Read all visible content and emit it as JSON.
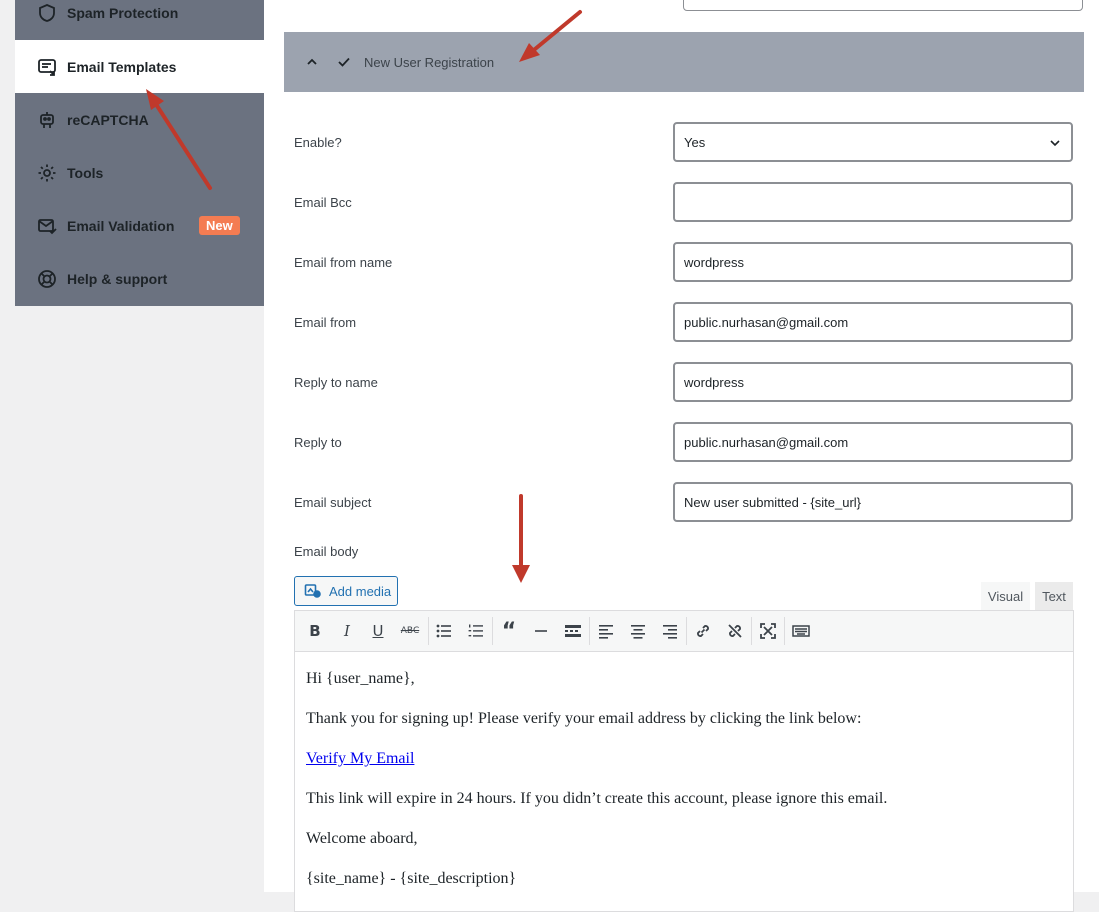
{
  "sidebar": {
    "items": [
      {
        "label": "Spam Protection",
        "icon": "shield-icon"
      },
      {
        "label": "Email Templates",
        "icon": "email-template-icon",
        "active": true
      },
      {
        "label": "reCAPTCHA",
        "icon": "robot-icon"
      },
      {
        "label": "Tools",
        "icon": "gear-icon"
      },
      {
        "label": "Email Validation",
        "icon": "envelope-check-icon",
        "badge": "New"
      },
      {
        "label": "Help & support",
        "icon": "lifebuoy-icon"
      }
    ],
    "active_bg": "#ffffff",
    "bg": "#6b7280",
    "badge_color": "#f47c52"
  },
  "accordion": {
    "title": "New User Registration",
    "bg": "#9ca3af"
  },
  "form": {
    "enable": {
      "label": "Enable?",
      "value": "Yes"
    },
    "bcc": {
      "label": "Email Bcc",
      "value": ""
    },
    "from_name": {
      "label": "Email from name",
      "value": "wordpress"
    },
    "from": {
      "label": "Email from",
      "value": "public.nurhasan@gmail.com"
    },
    "reply_name": {
      "label": "Reply to name",
      "value": "wordpress"
    },
    "reply_to": {
      "label": "Reply to",
      "value": "public.nurhasan@gmail.com"
    },
    "subject": {
      "label": "Email subject",
      "value": "New user submitted - {site_url}"
    },
    "body_label": "Email body"
  },
  "editor": {
    "add_media": "Add media",
    "tab_visual": "Visual",
    "tab_text": "Text",
    "toolbar": [
      "bold",
      "italic",
      "underline",
      "strikethrough",
      "bullet-list",
      "numbered-list",
      "blockquote",
      "horizontal-line",
      "read-more",
      "align-left",
      "align-center",
      "align-right",
      "insert-link",
      "remove-link",
      "fullscreen",
      "toolbar-toggle"
    ],
    "content": {
      "greeting": "Hi {user_name},",
      "line1": "Thank you for signing up! Please verify your email address by clicking the link below:",
      "link": "Verify My Email",
      "line2": "This link will expire in 24 hours. If you didn’t create this account, please ignore this email.",
      "line3": "Welcome aboard,",
      "signature": "{site_name} - {site_description}"
    }
  },
  "annotation_color": "#c0392b"
}
